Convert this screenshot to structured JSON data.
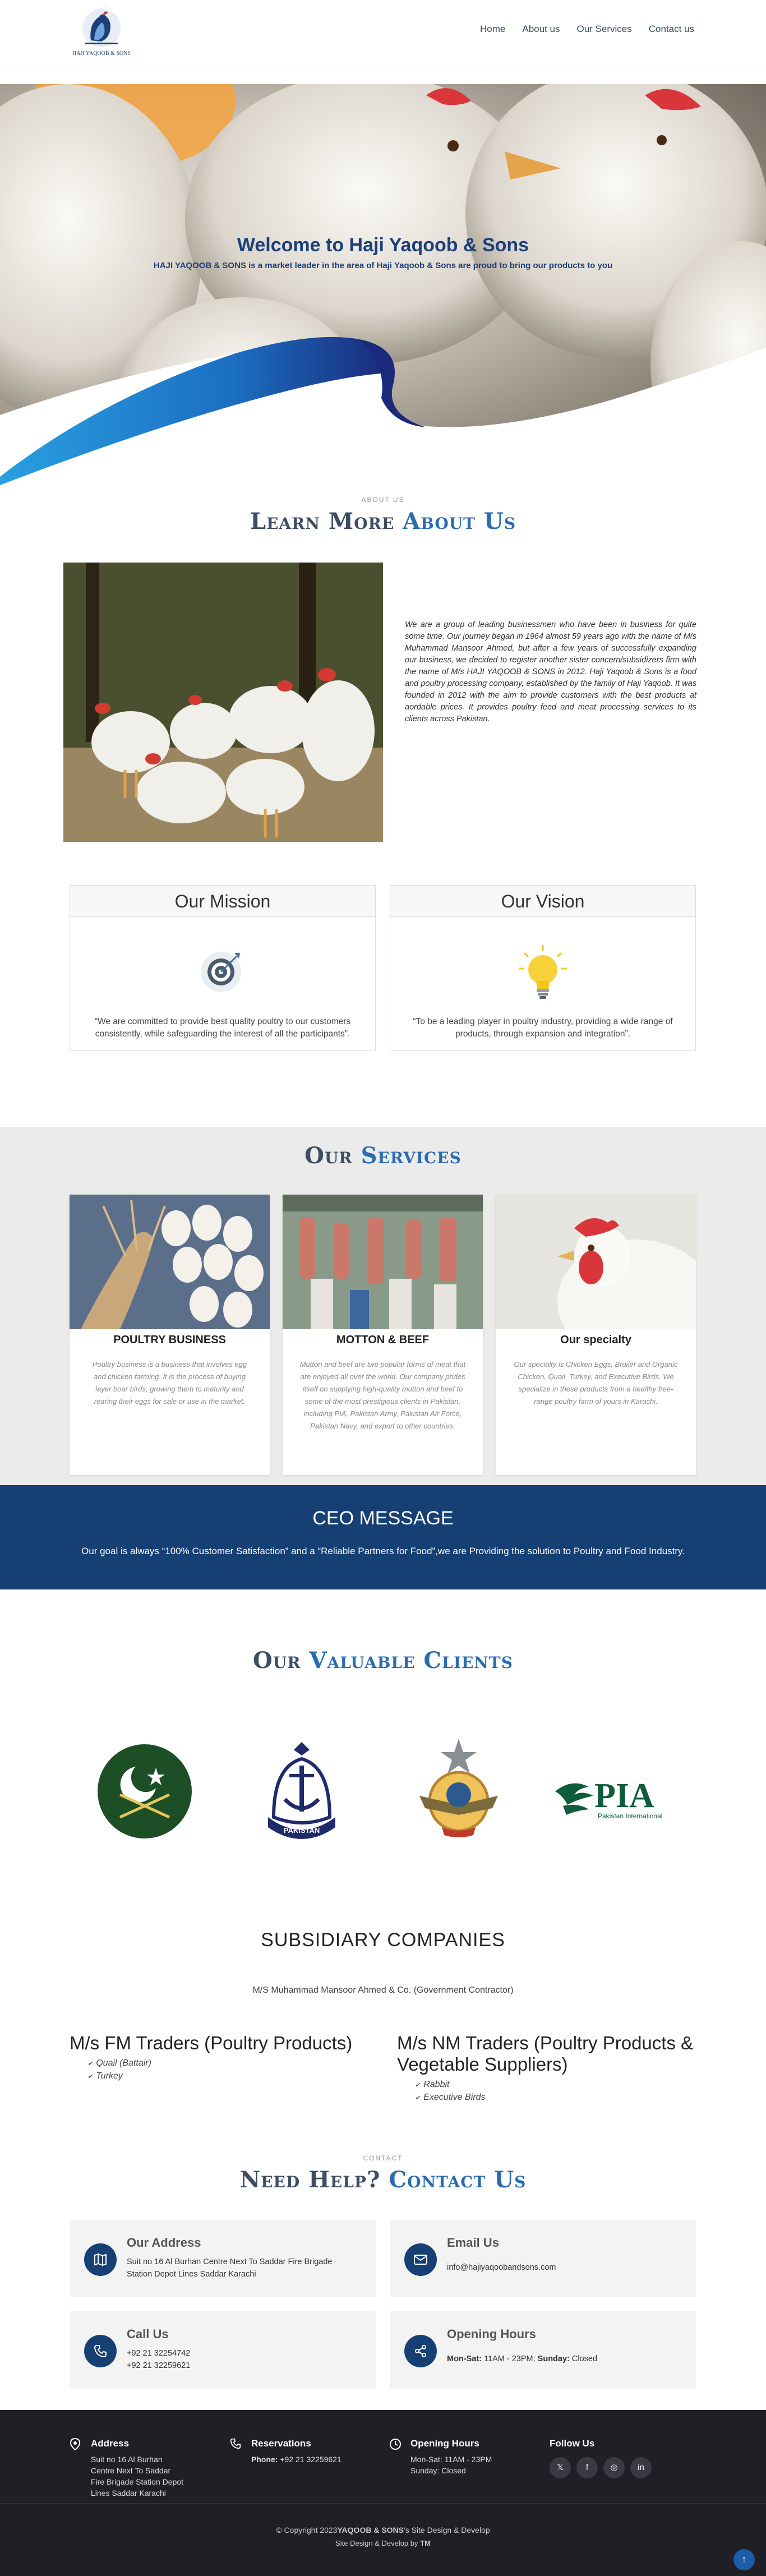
{
  "header": {
    "logo_text": "HAJI YAQOOB & SONS",
    "nav": [
      "Home",
      "About us",
      "Our Services",
      "Contact us"
    ]
  },
  "hero": {
    "title": "Welcome to Haji Yaqoob & Sons",
    "subtitle": "HAJI YAQOOB & SONS is a market leader in the area of Haji Yaqoob & Sons are proud to bring our products to you"
  },
  "about": {
    "eyebrow": "ABOUT US",
    "title_main": "Learn More ",
    "title_accent": "About Us",
    "text": "We are a group of leading businessmen who have been in business for quite some time. Our journey began in 1964 almost 59 years ago with the name of M/s Muhammad Mansoor Ahmed, but after a few years of successfully expanding our business, we decided to register another sister concern/subsidizers firm with the name of M/s HAJI YAQOOB & SONS in 2012. Haji Yaqoob & Sons is a food and poultry processing company, established by the family of Haji Yaqoob. It was founded in 2012 with the aim to provide customers with the best products at aordable prices. It provides poultry feed and meat processing services to its clients across Pakistan."
  },
  "mission": {
    "title": "Our Mission",
    "text": "“We are committed to provide best quality poultry to our customers consistently, while safeguarding the interest of all the participants”."
  },
  "vision": {
    "title": "Our Vision",
    "text": "“To be a leading player in poultry industry, providing a wide range of products, through expansion and integration”."
  },
  "services": {
    "title_main": "Our ",
    "title_accent": "Services",
    "cards": [
      {
        "title": "POULTRY BUSINESS",
        "text": "Poultry business is a business that involves egg and chicken farming. It is the process of buying layer boar birds, growing them to maturity and rearing their eggs for sale or use in the market."
      },
      {
        "title": "MOTTON & BEEF",
        "text": "Mutton and beef are two popular forms of meat that are enjoyed all over the world. Our company prides itself on supplying high-quality mutton and beef to some of the most prestigious clients in Pakistan, including PIA, Pakistan Army, Pakistan Air Force, Pakistan Navy, and export to other countries."
      },
      {
        "title": "Our specialty",
        "text": "Our specialty is Chicken Eggs, Broiler and Organic Chicken, Quail, Turkey, and Executive Birds. We specialize in these products from a healthy free-range poultry farm of yours in Karachi."
      }
    ]
  },
  "ceo": {
    "title": "CEO MESSAGE",
    "text": "Our goal is always “100% Customer Satisfaction” and a “Reliable Partners for Food”,we are Providing the solution to Poultry and Food Industry."
  },
  "clients": {
    "title_main": "Our ",
    "title_accent": "Valuable Clients",
    "navy_text": "PAKISTAN",
    "pia_text": "PIA",
    "pia_sub": "Pakistan International"
  },
  "subsidiary": {
    "title": "SUBSIDIARY COMPANIES",
    "owner": "M/S Muhammad Mansoor Ahmed & Co. (Government Contractor)",
    "companies": [
      {
        "name": "M/s FM Traders (Poultry Products)",
        "items": [
          "Quail (Battair)",
          "Turkey"
        ]
      },
      {
        "name": "M/s NM Traders (Poultry Products & Vegetable Suppliers)",
        "items": [
          "Rabbit",
          "Executive Birds"
        ]
      }
    ]
  },
  "contact": {
    "eyebrow": "CONTACT",
    "title_main": "Need Help? ",
    "title_accent": "Contact Us",
    "address": {
      "title": "Our Address",
      "line1": "Suit no 16 Al Burhan Centre Next To Saddar Fire Brigade",
      "line2": "Station Depot Lines Saddar Karachi"
    },
    "email": {
      "title": "Email Us",
      "line1": "info@hajiyaqoobandsons.com"
    },
    "call": {
      "title": "Call Us",
      "line1": "+92 21 32254742",
      "line2": "+92 21 32259621"
    },
    "hours": {
      "title": "Opening Hours",
      "days_label": "Mon-Sat:",
      "days_value": " 11AM - 23PM; ",
      "sun_label": "Sunday:",
      "sun_value": " Closed"
    }
  },
  "footer": {
    "address_head": "Address",
    "address_text": "Suit no 16 Al Burhan Centre Next To Saddar Fire Brigade Station Depot Lines Saddar Karachi",
    "res_head": "Reservations",
    "res_phone_label": "Phone:",
    "res_phone": " +92 21 32259621",
    "hours_head": "Opening Hours",
    "hours_line1": "Mon-Sat: 11AM - 23PM",
    "hours_line2": "Sunday: Closed",
    "follow_head": "Follow Us",
    "copyright_prefix": "© Copyright 2023",
    "copyright_brand": "YAQOOB & SONS",
    "copyright_suffix": "'s Site Design & Develop",
    "credit_prefix": "Site Design & Develop by ",
    "credit_brand": "TM"
  },
  "colors": {
    "primary": "#163f74",
    "accent": "#2b6cb0",
    "footer": "#1f1f26"
  }
}
